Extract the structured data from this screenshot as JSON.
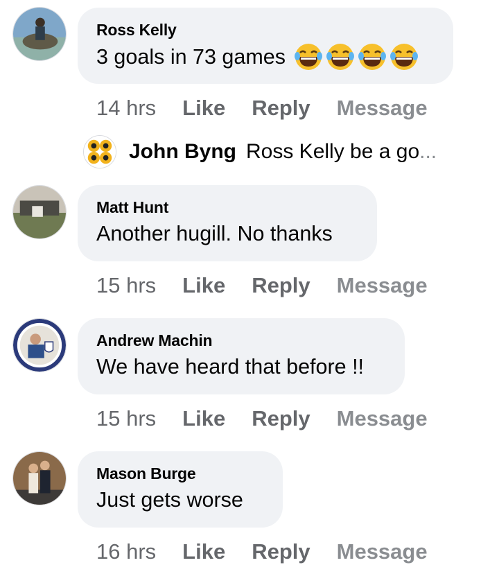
{
  "comments": [
    {
      "name": "Ross Kelly",
      "text": "3 goals in 73 games",
      "emojis": [
        "laughing-emoji",
        "laughing-emoji",
        "laughing-emoji",
        "laughing-emoji"
      ],
      "time": "14 hrs",
      "like": "Like",
      "reply": "Reply",
      "message": "Message",
      "reply_preview": {
        "name": "John Byng",
        "text": "Ross Kelly be a go",
        "ellipsis": "..."
      }
    },
    {
      "name": "Matt Hunt",
      "text": "Another hugill. No thanks",
      "time": "15 hrs",
      "like": "Like",
      "reply": "Reply",
      "message": "Message"
    },
    {
      "name": "Andrew Machin",
      "text": "We have heard that before !!",
      "time": "15 hrs",
      "like": "Like",
      "reply": "Reply",
      "message": "Message"
    },
    {
      "name": "Mason Burge",
      "text": "Just gets worse",
      "time": "16 hrs",
      "like": "Like",
      "reply": "Reply",
      "message": "Message"
    }
  ],
  "colors": {
    "bubble": "#f0f2f5",
    "action_text": "#65676b",
    "message_text": "#8a8d91",
    "emoji_face": "#f7c02b"
  }
}
